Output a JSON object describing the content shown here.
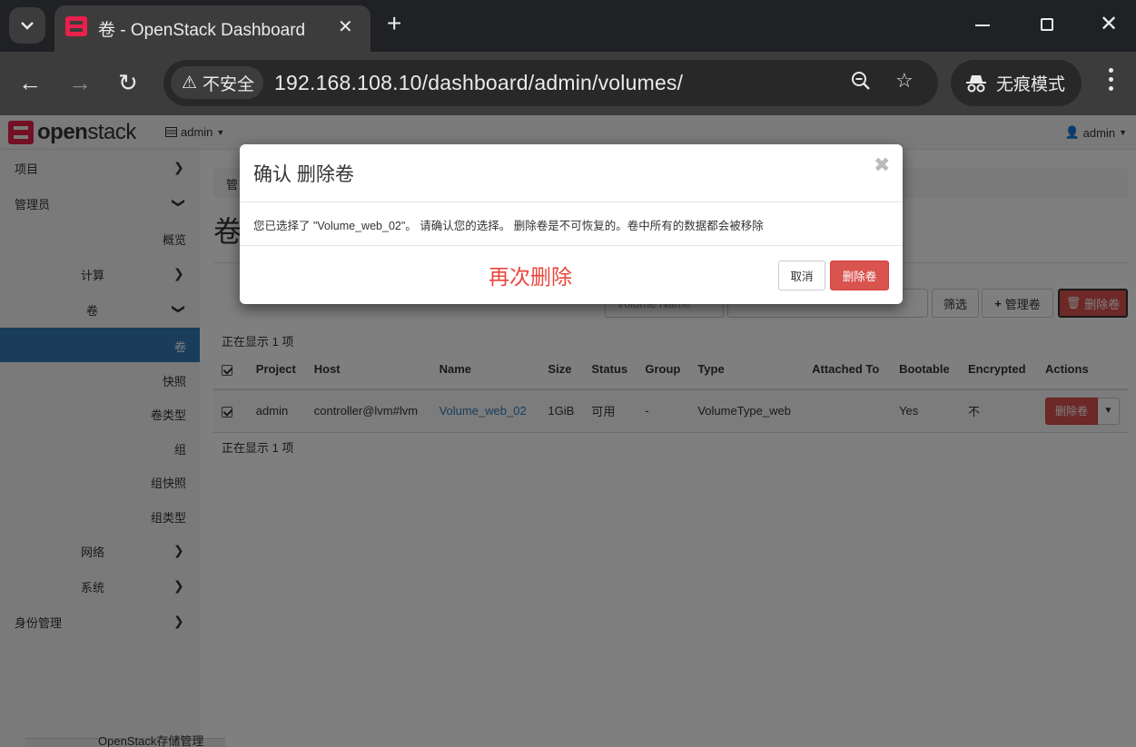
{
  "browser": {
    "tab_title": "卷 - OpenStack Dashboard",
    "security_chip": "不安全",
    "url": "192.168.108.10/dashboard/admin/volumes/",
    "incognito_label": "无痕模式"
  },
  "topnav": {
    "logo_text_bold": "open",
    "logo_text_light": "stack",
    "project": "admin",
    "user": "admin"
  },
  "sidebar": {
    "items": [
      {
        "label": "项目"
      },
      {
        "label": "管理员"
      },
      {
        "label": "概览"
      },
      {
        "label": "计算"
      },
      {
        "label": "卷"
      },
      {
        "label": "卷"
      },
      {
        "label": "快照"
      },
      {
        "label": "卷类型"
      },
      {
        "label": "组"
      },
      {
        "label": "组快照"
      },
      {
        "label": "组类型"
      },
      {
        "label": "网络"
      },
      {
        "label": "系统"
      },
      {
        "label": "身份管理"
      }
    ]
  },
  "main": {
    "breadcrumb": "管",
    "page_title": "卷",
    "filter_field_value": "Volume Name",
    "filter_button": "筛选",
    "manage_button": "管理卷",
    "delete_button": "删除卷",
    "count_top": "正在显示 1 项",
    "count_bottom": "正在显示 1 项",
    "table": {
      "headers": [
        "Project",
        "Host",
        "Name",
        "Size",
        "Status",
        "Group",
        "Type",
        "Attached To",
        "Bootable",
        "Encrypted",
        "Actions"
      ],
      "rows": [
        {
          "project": "admin",
          "host": "controller@lvm#lvm",
          "name": "Volume_web_02",
          "size": "1GiB",
          "status": "可用",
          "group": "-",
          "type": "VolumeType_web",
          "attached_to": "",
          "bootable": "Yes",
          "encrypted": "不",
          "action": "删除卷"
        }
      ]
    }
  },
  "peek_text": "OpenStack存储管理",
  "modal": {
    "title": "确认 删除卷",
    "body": "您已选择了 \"Volume_web_02\"。 请确认您的选择。 删除卷是不可恢复的。卷中所有的数据都会被移除",
    "annotation": "再次删除",
    "cancel": "取消",
    "confirm": "删除卷"
  }
}
